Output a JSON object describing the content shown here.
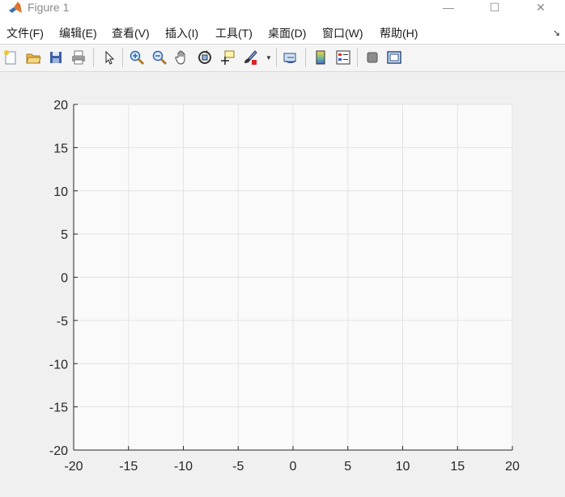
{
  "window": {
    "title": "Figure 1",
    "controls": {
      "minimize": "—",
      "maximize": "☐",
      "close": "✕"
    }
  },
  "menubar": {
    "items": [
      {
        "label": "文件(F)"
      },
      {
        "label": "编辑(E)"
      },
      {
        "label": "查看(V)"
      },
      {
        "label": "插入(I)"
      },
      {
        "label": "工具(T)"
      },
      {
        "label": "桌面(D)"
      },
      {
        "label": "窗口(W)"
      },
      {
        "label": "帮助(H)"
      }
    ],
    "overflow_icon": "dock-arrow-icon"
  },
  "toolbar": {
    "buttons": [
      {
        "name": "new-figure-icon"
      },
      {
        "name": "open-file-icon"
      },
      {
        "name": "save-icon"
      },
      {
        "name": "print-icon"
      },
      {
        "name": "edit-plot-icon"
      },
      {
        "name": "zoom-in-icon"
      },
      {
        "name": "zoom-out-icon"
      },
      {
        "name": "pan-icon"
      },
      {
        "name": "rotate-3d-icon"
      },
      {
        "name": "data-cursor-icon"
      },
      {
        "name": "brush-icon"
      },
      {
        "name": "link-plot-icon"
      },
      {
        "name": "colorbar-icon"
      },
      {
        "name": "legend-icon"
      },
      {
        "name": "hide-plot-tools-icon"
      },
      {
        "name": "show-plot-tools-icon"
      }
    ]
  },
  "chart_data": {
    "type": "line",
    "title": "",
    "xlabel": "",
    "ylabel": "",
    "xlim": [
      -20,
      20
    ],
    "ylim": [
      -20,
      20
    ],
    "x_ticks": [
      "-20",
      "-15",
      "-10",
      "-5",
      "0",
      "5",
      "10",
      "15",
      "20"
    ],
    "y_ticks": [
      "20",
      "15",
      "10",
      "5",
      "0",
      "-5",
      "-10",
      "-15",
      "-20"
    ],
    "grid": true,
    "series": []
  }
}
